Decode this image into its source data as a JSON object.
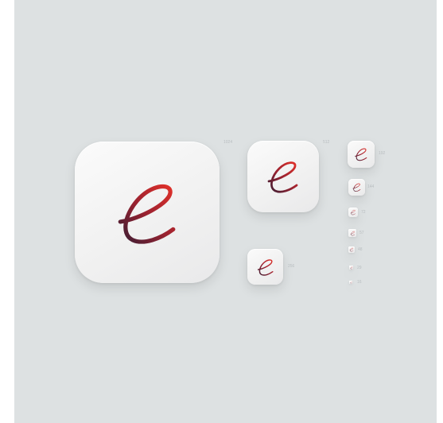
{
  "icon_set": {
    "glyph": "cursive-e-icon",
    "colors": {
      "background": "#dde1e2",
      "icon_face": "#f3f3f3",
      "gradient_start": "#3b1e34",
      "gradient_end": "#e2312a"
    },
    "sizes": [
      {
        "label": "1024"
      },
      {
        "label": "512"
      },
      {
        "label": "256"
      },
      {
        "label": "192"
      },
      {
        "label": "144"
      },
      {
        "label": "72"
      },
      {
        "label": "57"
      },
      {
        "label": "48"
      },
      {
        "label": "29"
      },
      {
        "label": "16"
      }
    ]
  }
}
